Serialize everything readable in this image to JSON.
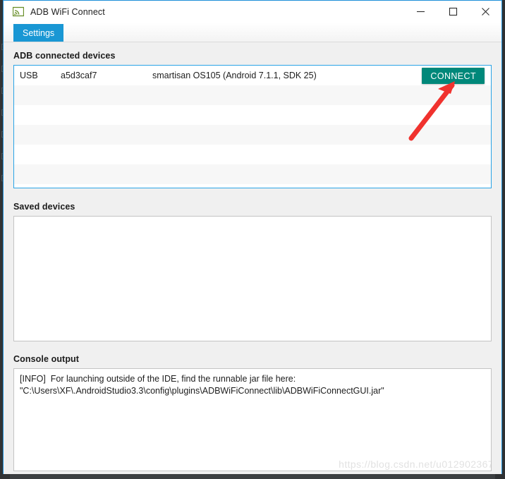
{
  "window": {
    "title": "ADB WiFi Connect",
    "icon": "cast-wifi-icon",
    "controls": [
      {
        "name": "minimize",
        "glyph": "minimize-icon"
      },
      {
        "name": "maximize",
        "glyph": "maximize-icon"
      },
      {
        "name": "close",
        "glyph": "close-icon"
      }
    ]
  },
  "tabs": [
    {
      "label": "Settings",
      "active": true
    }
  ],
  "sections": {
    "adb_connected": {
      "label": "ADB connected devices",
      "columns": [
        "type",
        "serial",
        "model"
      ],
      "rows": [
        {
          "type": "USB",
          "serial": "a5d3caf7",
          "model": "smartisan OS105 (Android 7.1.1, SDK 25)",
          "action": "CONNECT"
        }
      ],
      "empty_row_count": 5
    },
    "saved_devices": {
      "label": "Saved devices",
      "rows": []
    },
    "console": {
      "label": "Console output",
      "lines": [
        "[INFO]  For launching outside of the IDE, find the runnable jar file here:",
        "\"C:\\Users\\XF\\.AndroidStudio3.3\\config\\plugins\\ADBWiFiConnect\\lib\\ADBWiFiConnectGUI.jar\""
      ]
    }
  },
  "watermark": "https://blog.csdn.net/u012902367",
  "colors": {
    "tab_active": "#1997d4",
    "connect_button": "#00887a",
    "panel_focus_border": "#2aa4e6",
    "annotation_arrow": "#f0322e",
    "window_border": "#1e8fd8"
  }
}
